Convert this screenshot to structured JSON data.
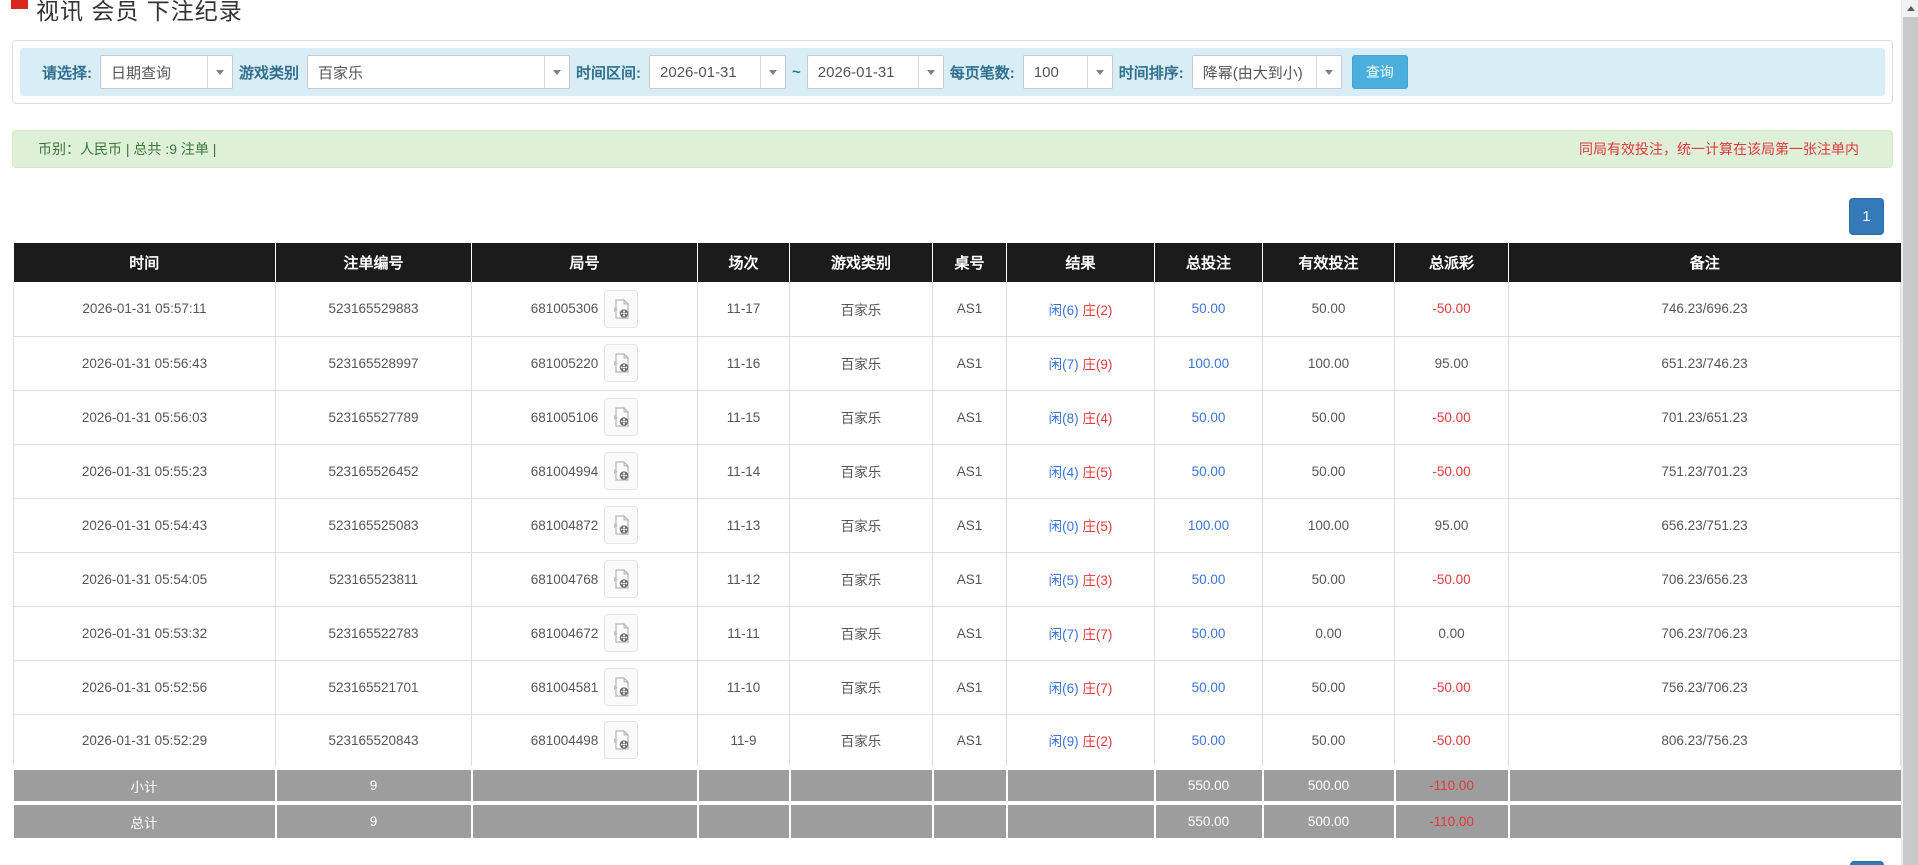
{
  "page": {
    "title": "视讯 会员 下注纪录"
  },
  "colors": {
    "header-bg": "#1b1b1b",
    "accent-blue": "#337ab7",
    "link-blue": "#3b73de",
    "red": "#e4393c",
    "info-bg": "#d9edf7",
    "success-bg": "#dff0d8",
    "success-text": "#3c763d",
    "label-blue": "#31708f",
    "button-blue": "#4aafdd",
    "footer-gray": "#9d9d9d"
  },
  "filters": {
    "select_label": "请选择:",
    "select_value": "日期查询",
    "game_label": "游戏类别",
    "game_value": "百家乐",
    "range_label": "时间区间:",
    "date_from": "2026-01-31",
    "range_separator": "~",
    "date_to": "2026-01-31",
    "page_size_label": "每页笔数:",
    "page_size_value": "100",
    "sort_label": "时间排序:",
    "sort_value": "降幂(由大到小)",
    "search_button": "查询"
  },
  "summary": {
    "left": "币别：人民币 | 总共 :9 注单 |",
    "right_notice": "同局有效投注，统一计算在该局第一张注单内"
  },
  "pagination": {
    "page": "1"
  },
  "table": {
    "headers": [
      "时间",
      "注单编号",
      "局号",
      "场次",
      "游戏类别",
      "桌号",
      "结果",
      "总投注",
      "有效投注",
      "总派彩",
      "备注"
    ],
    "rows": [
      {
        "time": "2026-01-31 05:57:11",
        "bet_id": "523165529883",
        "round": "681005306",
        "session": "11-17",
        "game": "百家乐",
        "table": "AS1",
        "player": "闲(6)",
        "banker": "庄(2)",
        "total_bet": "50.00",
        "valid_bet": "50.00",
        "payout": "-50.00",
        "note": "746.23/696.23"
      },
      {
        "time": "2026-01-31 05:56:43",
        "bet_id": "523165528997",
        "round": "681005220",
        "session": "11-16",
        "game": "百家乐",
        "table": "AS1",
        "player": "闲(7)",
        "banker": "庄(9)",
        "total_bet": "100.00",
        "valid_bet": "100.00",
        "payout": "95.00",
        "note": "651.23/746.23"
      },
      {
        "time": "2026-01-31 05:56:03",
        "bet_id": "523165527789",
        "round": "681005106",
        "session": "11-15",
        "game": "百家乐",
        "table": "AS1",
        "player": "闲(8)",
        "banker": "庄(4)",
        "total_bet": "50.00",
        "valid_bet": "50.00",
        "payout": "-50.00",
        "note": "701.23/651.23"
      },
      {
        "time": "2026-01-31 05:55:23",
        "bet_id": "523165526452",
        "round": "681004994",
        "session": "11-14",
        "game": "百家乐",
        "table": "AS1",
        "player": "闲(4)",
        "banker": "庄(5)",
        "total_bet": "50.00",
        "valid_bet": "50.00",
        "payout": "-50.00",
        "note": "751.23/701.23"
      },
      {
        "time": "2026-01-31 05:54:43",
        "bet_id": "523165525083",
        "round": "681004872",
        "session": "11-13",
        "game": "百家乐",
        "table": "AS1",
        "player": "闲(0)",
        "banker": "庄(5)",
        "total_bet": "100.00",
        "valid_bet": "100.00",
        "payout": "95.00",
        "note": "656.23/751.23"
      },
      {
        "time": "2026-01-31 05:54:05",
        "bet_id": "523165523811",
        "round": "681004768",
        "session": "11-12",
        "game": "百家乐",
        "table": "AS1",
        "player": "闲(5)",
        "banker": "庄(3)",
        "total_bet": "50.00",
        "valid_bet": "50.00",
        "payout": "-50.00",
        "note": "706.23/656.23"
      },
      {
        "time": "2026-01-31 05:53:32",
        "bet_id": "523165522783",
        "round": "681004672",
        "session": "11-11",
        "game": "百家乐",
        "table": "AS1",
        "player": "闲(7)",
        "banker": "庄(7)",
        "total_bet": "50.00",
        "valid_bet": "0.00",
        "payout": "0.00",
        "note": "706.23/706.23"
      },
      {
        "time": "2026-01-31 05:52:56",
        "bet_id": "523165521701",
        "round": "681004581",
        "session": "11-10",
        "game": "百家乐",
        "table": "AS1",
        "player": "闲(6)",
        "banker": "庄(7)",
        "total_bet": "50.00",
        "valid_bet": "50.00",
        "payout": "-50.00",
        "note": "756.23/706.23"
      },
      {
        "time": "2026-01-31 05:52:29",
        "bet_id": "523165520843",
        "round": "681004498",
        "session": "11-9",
        "game": "百家乐",
        "table": "AS1",
        "player": "闲(9)",
        "banker": "庄(2)",
        "total_bet": "50.00",
        "valid_bet": "50.00",
        "payout": "-50.00",
        "note": "806.23/756.23"
      }
    ],
    "subtotal": {
      "label": "小计",
      "count": "9",
      "total_bet": "550.00",
      "valid_bet": "500.00",
      "payout": "-110.00"
    },
    "total": {
      "label": "总计",
      "count": "9",
      "total_bet": "550.00",
      "valid_bet": "500.00",
      "payout": "-110.00"
    }
  }
}
